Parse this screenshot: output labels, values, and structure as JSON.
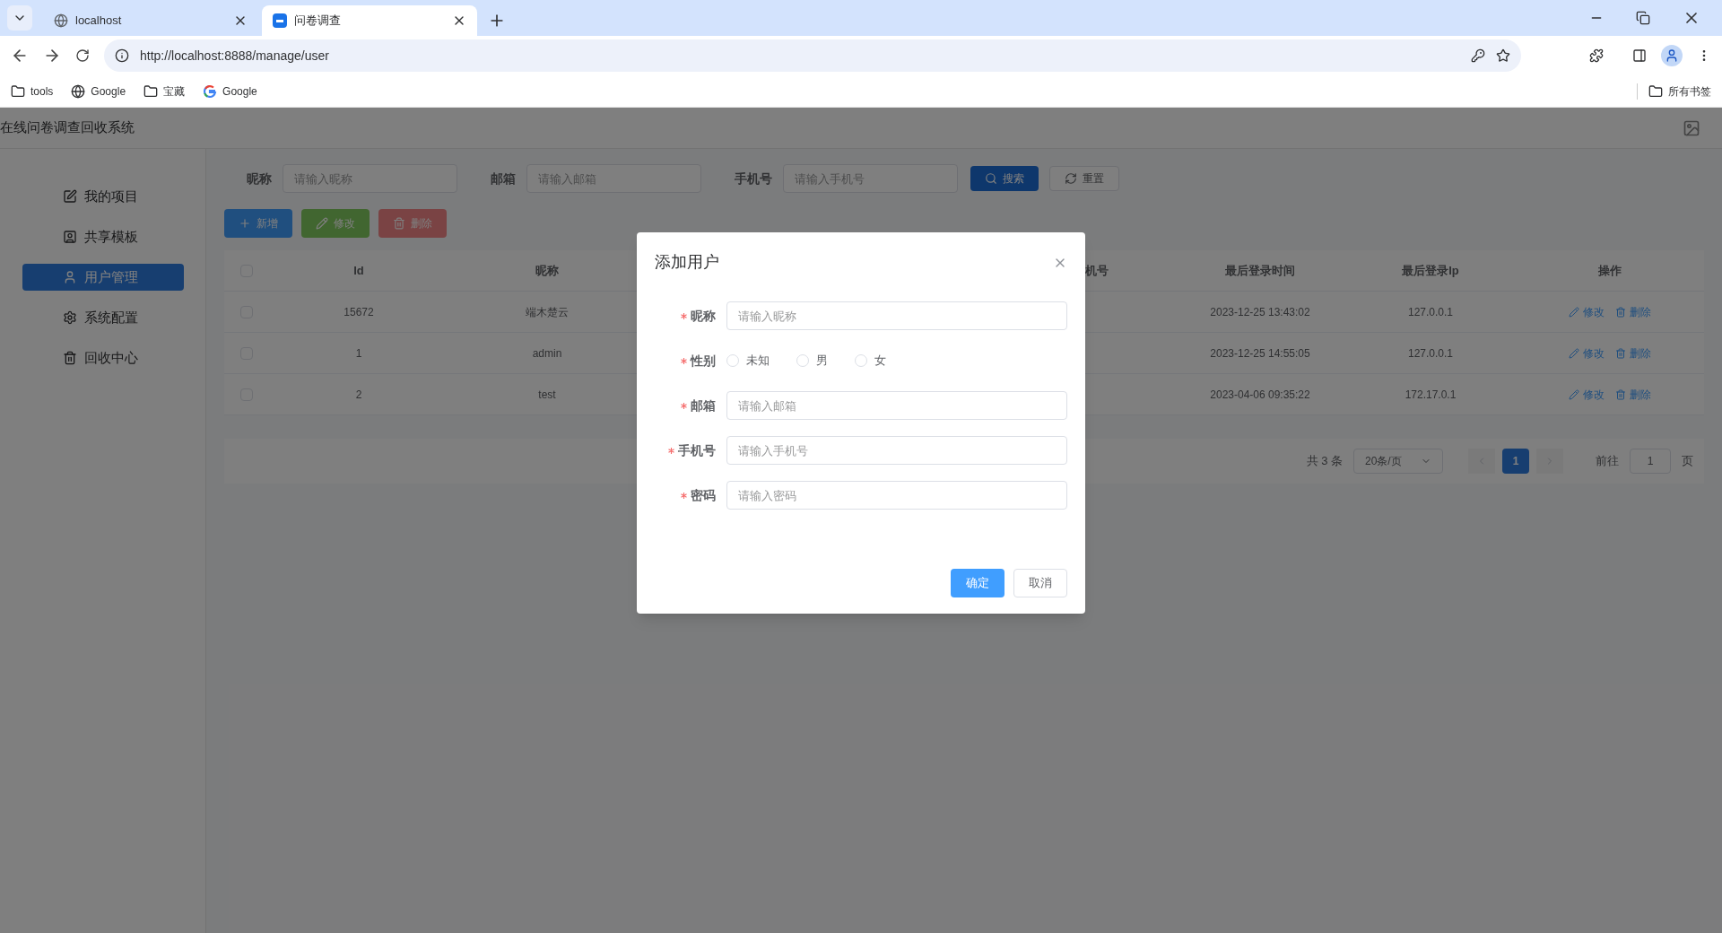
{
  "browser": {
    "tabs": [
      {
        "title": "localhost",
        "kind": "globe",
        "selected": false
      },
      {
        "title": "问卷调查",
        "kind": "app",
        "selected": true
      }
    ],
    "url": "http://localhost:8888/manage/user",
    "bookmarks": [
      {
        "label": "tools",
        "kind": "folder"
      },
      {
        "label": "Google",
        "kind": "globe"
      },
      {
        "label": "宝藏",
        "kind": "folder"
      },
      {
        "label": "Google",
        "kind": "google"
      }
    ],
    "all_bookmarks": "所有书签"
  },
  "app": {
    "title": "在线问卷调查回收系统"
  },
  "sidebar": {
    "items": [
      {
        "label": "我的项目",
        "kind": "project",
        "selected": false
      },
      {
        "label": "共享模板",
        "kind": "template",
        "selected": false
      },
      {
        "label": "用户管理",
        "kind": "user",
        "selected": true
      },
      {
        "label": "系统配置",
        "kind": "settings",
        "selected": false
      },
      {
        "label": "回收中心",
        "kind": "trash",
        "selected": false
      }
    ]
  },
  "search": {
    "fields": [
      {
        "label": "昵称",
        "placeholder": "请输入昵称"
      },
      {
        "label": "邮箱",
        "placeholder": "请输入邮箱"
      },
      {
        "label": "手机号",
        "placeholder": "请输入手机号"
      }
    ],
    "buttons": [
      {
        "label": "搜索",
        "kind": "search"
      },
      {
        "label": "重置",
        "kind": "reset"
      }
    ]
  },
  "toolbar": [
    {
      "label": "新增",
      "kind": "add",
      "disabled": false
    },
    {
      "label": "修改",
      "kind": "edit",
      "disabled": true
    },
    {
      "label": "删除",
      "kind": "delete",
      "disabled": true
    }
  ],
  "table": {
    "header_checked": false,
    "columns": [
      {
        "label": "Id",
        "kind": "full"
      },
      {
        "label": "昵称",
        "kind": "full"
      },
      {
        "label": "机号",
        "kind": "cut"
      },
      {
        "label": "最后登录时间",
        "kind": "full"
      },
      {
        "label": "最后登录Ip",
        "kind": "full"
      },
      {
        "label": "操作",
        "kind": "full"
      }
    ],
    "rows": [
      {
        "checked": false,
        "id": "15672",
        "name": "端木楚云",
        "last_login_time": "2023-12-25 13:43:02",
        "last_login_ip": "127.0.0.1",
        "actions": [
          "修改",
          "删除"
        ]
      },
      {
        "checked": false,
        "id": "1",
        "name": "admin",
        "last_login_time": "2023-12-25 14:55:05",
        "last_login_ip": "127.0.0.1",
        "actions": [
          "修改",
          "删除"
        ]
      },
      {
        "checked": false,
        "id": "2",
        "name": "test",
        "last_login_time": "2023-04-06 09:35:22",
        "last_login_ip": "172.17.0.1",
        "actions": [
          "修改",
          "删除"
        ]
      }
    ]
  },
  "pagination": {
    "total": "共 3 条",
    "page_size": "20条/页",
    "pages": [
      {
        "label": "1",
        "selected": true
      }
    ],
    "goto_label": "前往",
    "goto_value": "1",
    "page_suffix": "页"
  },
  "dialog": {
    "title": "添加用户",
    "fields": [
      {
        "label": "昵称",
        "required": true,
        "kind": "text",
        "placeholder": "请输入昵称"
      },
      {
        "label": "性别",
        "required": true,
        "kind": "radio",
        "options": [
          {
            "label": "未知",
            "selected": false
          },
          {
            "label": "男",
            "selected": false
          },
          {
            "label": "女",
            "selected": false
          }
        ]
      },
      {
        "label": "邮箱",
        "required": true,
        "kind": "text",
        "placeholder": "请输入邮箱"
      },
      {
        "label": "手机号",
        "required": true,
        "kind": "text",
        "placeholder": "请输入手机号"
      },
      {
        "label": "密码",
        "required": true,
        "kind": "text",
        "placeholder": "请输入密码"
      }
    ],
    "buttons": [
      {
        "label": "确定",
        "kind": "primary"
      },
      {
        "label": "取消",
        "kind": "default"
      }
    ]
  }
}
